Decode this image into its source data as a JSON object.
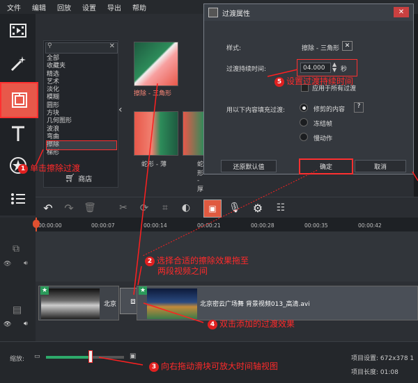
{
  "menu": [
    "文件",
    "编辑",
    "回放",
    "设置",
    "导出",
    "帮助"
  ],
  "categories": [
    "全部",
    "收藏夹",
    "精选",
    "艺术",
    "淡化",
    "模糊",
    "圆形",
    "方块",
    "几何图形",
    "波浪",
    "弯曲",
    "擦除",
    "梯形"
  ],
  "store_label": "商店",
  "thumbs": [
    {
      "label": "擦除 - 三角形",
      "selected": true
    },
    {
      "label": "蛇形 - 薄",
      "selected": false
    },
    {
      "label": "蛇形 - 厚",
      "selected": false
    }
  ],
  "dialog": {
    "title": "过渡属性",
    "style_label": "样式:",
    "style_value": "擦除 - 三角形",
    "duration_label": "过渡持续时间:",
    "duration_value": "04.000",
    "duration_unit": "秒",
    "apply_all": "应用于所有过渡",
    "fill_label": "用以下内容填充过渡:",
    "fill_options": [
      "修剪的内容",
      "冻结帧",
      "慢动作"
    ],
    "help": "?",
    "reset": "还原默认值",
    "ok": "确定",
    "cancel": "取消"
  },
  "ruler": [
    "00:00:00",
    "00:00:07",
    "00:00:14",
    "00:00:21",
    "00:00:28",
    "00:00:35",
    "00:00:42"
  ],
  "clips": {
    "left_label": "北京",
    "right_label": "北京密云广场舞 背景视频013_高清.avi"
  },
  "bottom": {
    "zoom_label": "缩放:",
    "project_settings": "项目设置: 672x378 1",
    "project_length": "项目长度: 01:08"
  },
  "annotations": {
    "a1": "单击擦除过渡",
    "a2_line1": "选择合适的擦除效果拖至",
    "a2_line2": "两段视频之间",
    "a3": "向右拖动滑块可放大时间轴视图",
    "a4": "双击添加的过渡效果",
    "a5": "设置过渡持续时间",
    "n1": "1",
    "n2": "2",
    "n3": "3",
    "n4": "4",
    "n5": "5"
  }
}
